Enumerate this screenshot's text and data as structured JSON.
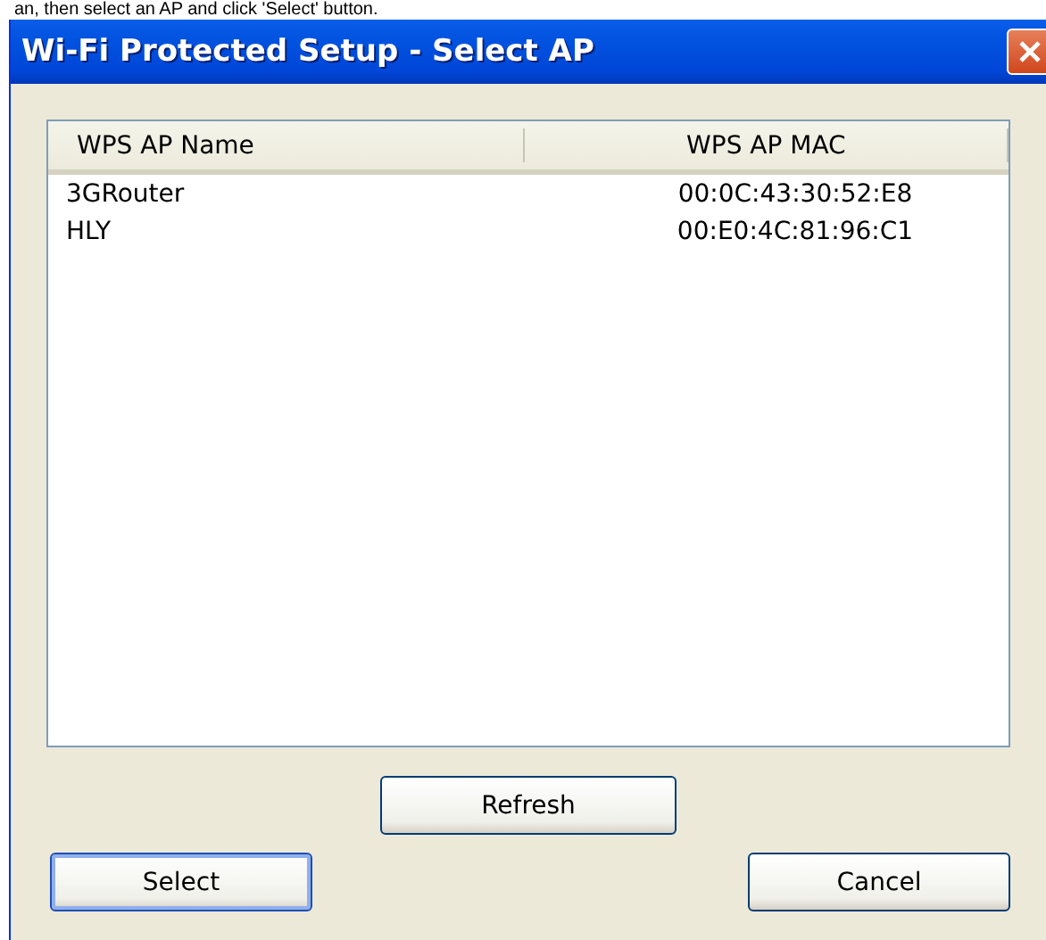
{
  "caption": "an, then select an AP and click 'Select' button.",
  "window": {
    "title": "Wi-Fi Protected Setup - Select AP"
  },
  "table": {
    "columns": [
      "WPS AP Name",
      "WPS AP MAC"
    ],
    "rows": [
      {
        "cells": [
          "3GRouter",
          "00:0C:43:30:52:E8"
        ],
        "selected": false
      },
      {
        "cells": [
          "HLY",
          "00:E0:4C:81:96:C1"
        ],
        "selected": false
      }
    ]
  },
  "refresh_button": {
    "label": "Refresh",
    "default": false
  },
  "buttons": [
    {
      "label": "Select",
      "default": true
    },
    {
      "label": "Cancel",
      "default": false
    }
  ]
}
